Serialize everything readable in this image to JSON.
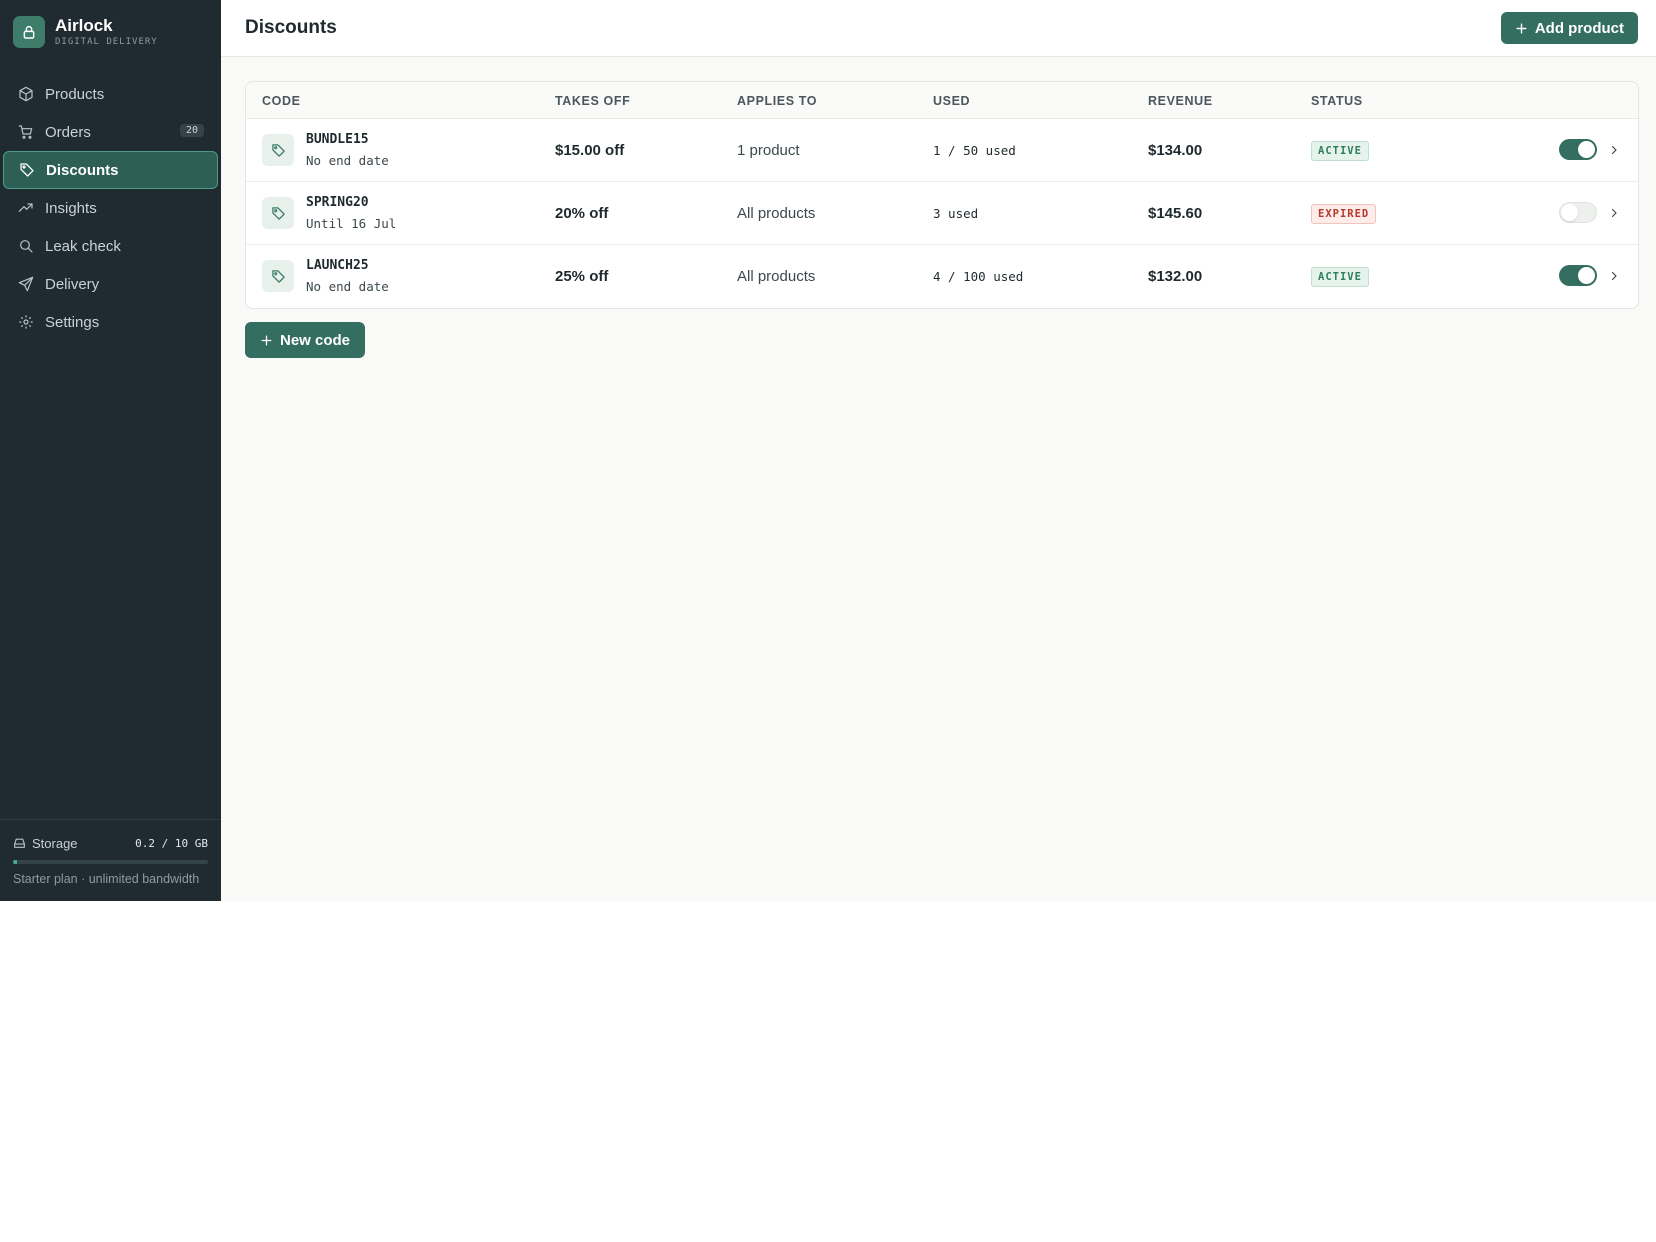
{
  "brand": {
    "name": "Airlock",
    "subtitle": "DIGITAL DELIVERY",
    "logo_icon": "lock-icon"
  },
  "sidebar": {
    "items": [
      {
        "label": "Products",
        "icon": "box-icon",
        "active": false
      },
      {
        "label": "Orders",
        "icon": "cart-icon",
        "badge": "20",
        "active": false
      },
      {
        "label": "Discounts",
        "icon": "tag-icon",
        "active": true
      },
      {
        "label": "Insights",
        "icon": "trend-icon",
        "active": false
      },
      {
        "label": "Leak check",
        "icon": "search-icon",
        "active": false
      },
      {
        "label": "Delivery",
        "icon": "send-icon",
        "active": false
      },
      {
        "label": "Settings",
        "icon": "gear-icon",
        "active": false
      }
    ],
    "storage": {
      "label": "Storage",
      "value": "0.2 / 10 GB",
      "fraction": 0.02,
      "plan": "Starter plan · unlimited bandwidth"
    }
  },
  "header": {
    "title": "Discounts",
    "add_button": "Add product"
  },
  "table": {
    "columns": [
      "CODE",
      "TAKES OFF",
      "APPLIES TO",
      "USED",
      "REVENUE",
      "STATUS"
    ],
    "rows": [
      {
        "code": "BUNDLE15",
        "end": "No end date",
        "takes_off": "$15.00 off",
        "applies_to": "1 product",
        "used": "1 / 50 used",
        "revenue": "$134.00",
        "status": "ACTIVE",
        "enabled": true
      },
      {
        "code": "SPRING20",
        "end": "Until 16 Jul",
        "takes_off": "20% off",
        "applies_to": "All products",
        "used": "3 used",
        "revenue": "$145.60",
        "status": "EXPIRED",
        "enabled": false
      },
      {
        "code": "LAUNCH25",
        "end": "No end date",
        "takes_off": "25% off",
        "applies_to": "All products",
        "used": "4 / 100 used",
        "revenue": "$132.00",
        "status": "ACTIVE",
        "enabled": true
      }
    ]
  },
  "new_code_button": "New code",
  "colors": {
    "sidebar_bg": "#1f2b30",
    "accent": "#336e60",
    "active_badge": "#2f7d60",
    "expired_badge": "#b43a2e"
  }
}
